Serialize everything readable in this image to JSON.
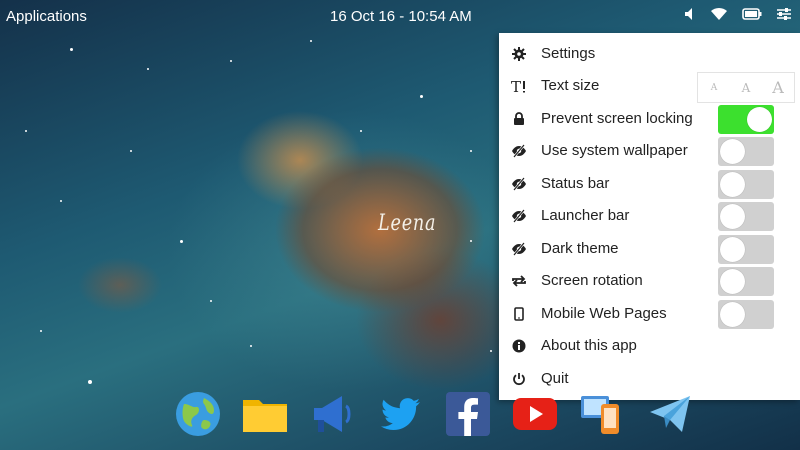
{
  "topbar": {
    "applications_label": "Applications",
    "clock": "16 Oct 16 - 10:54 AM",
    "tray_icons": [
      "volume-icon",
      "wifi-icon",
      "battery-icon",
      "settings-sliders-icon"
    ]
  },
  "wallpaper_label": "Leena",
  "menu": {
    "settings": "Settings",
    "text_size": "Text size",
    "text_size_options": [
      "A",
      "A",
      "A"
    ],
    "prevent_locking": "Prevent screen locking",
    "prevent_locking_on": true,
    "system_wallpaper": "Use system wallpaper",
    "system_wallpaper_on": false,
    "status_bar": "Status bar",
    "status_bar_on": false,
    "launcher_bar": "Launcher bar",
    "launcher_bar_on": false,
    "dark_theme": "Dark theme",
    "dark_theme_on": false,
    "screen_rotation": "Screen rotation",
    "screen_rotation_on": false,
    "mobile_web": "Mobile Web Pages",
    "mobile_web_on": false,
    "about": "About this app",
    "quit": "Quit"
  },
  "dock": [
    "globe-icon",
    "folder-icon",
    "megaphone-icon",
    "twitter-icon",
    "facebook-icon",
    "youtube-icon",
    "devices-icon",
    "paper-plane-icon"
  ],
  "colors": {
    "toggle_on": "#3ce02e",
    "toggle_off": "#d0d0d0",
    "menu_bg": "#ffffff"
  }
}
